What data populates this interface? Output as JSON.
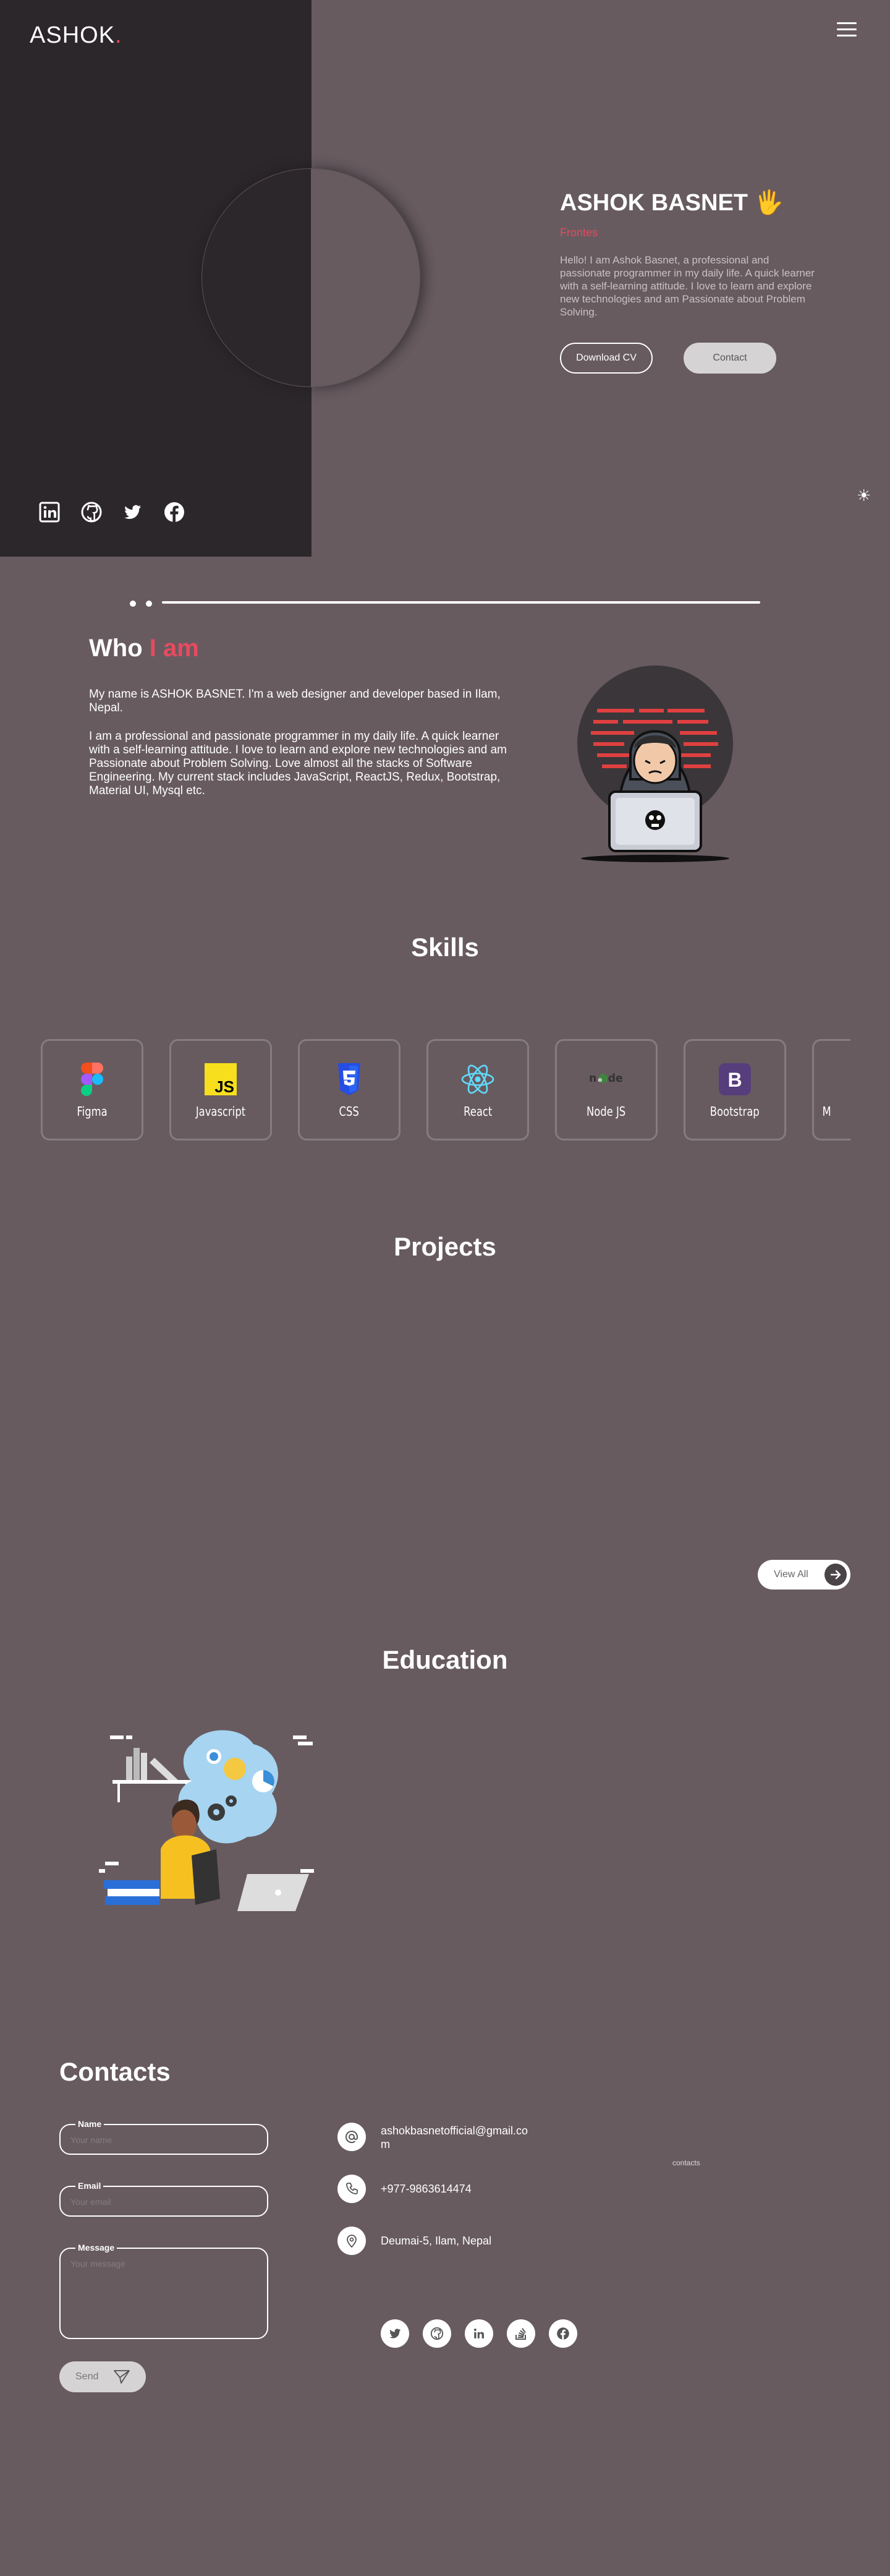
{
  "header": {
    "logo": "ASHOK",
    "logo_dot": "."
  },
  "hero": {
    "name": "ASHOK BASNET",
    "wave": "🖐",
    "role": "Frontes",
    "bio": "Hello! I am Ashok Basnet, a professional and passionate programmer in my daily life. A quick learner with a self-learning attitude. I love to learn and explore new technologies and am Passionate about Problem Solving.",
    "download_cv": "Download CV",
    "contact": "Contact",
    "theme_toggle": "☀",
    "socials": [
      "linkedin-icon",
      "github-icon",
      "twitter-icon",
      "facebook-icon"
    ]
  },
  "about": {
    "title_a": "Who",
    "title_b": "I am",
    "p1": "My name is ASHOK BASNET. I'm a web designer and developer based in Ilam, Nepal.",
    "p2": "I am a professional and passionate programmer in my daily life. A quick learner with a self-learning attitude. I love to learn and explore new technologies and am Passionate about Problem Solving. Love almost all the stacks of Software Engineering. My current stack includes JavaScript, ReactJS, Redux, Bootstrap, Material UI, Mysql etc."
  },
  "skills": {
    "title": "Skills",
    "items": [
      {
        "label": "Figma",
        "icon": "figma-icon"
      },
      {
        "label": "Javascript",
        "icon": "javascript-icon"
      },
      {
        "label": "CSS",
        "icon": "css-icon"
      },
      {
        "label": "React",
        "icon": "react-icon"
      },
      {
        "label": "Node JS",
        "icon": "nodejs-icon"
      },
      {
        "label": "Bootstrap",
        "icon": "bootstrap-icon"
      },
      {
        "label": "M",
        "icon": "mui-icon"
      }
    ]
  },
  "projects": {
    "title": "Projects",
    "view_all": "View All"
  },
  "education": {
    "title": "Education"
  },
  "contacts": {
    "title": "Contacts",
    "name_label": "Name",
    "name_placeholder": "Your name",
    "email_label": "Email",
    "email_placeholder": "Your email",
    "message_label": "Message",
    "message_placeholder": "Your message",
    "send": "Send",
    "email": "ashokbasnetofficial@gmail.com",
    "phone": "+977-9863614474",
    "address": "Deumai-5, Ilam, Nepal",
    "broken_image_alt": "contacts",
    "socials": [
      "twitter-icon",
      "github-icon",
      "linkedin-icon",
      "stackoverflow-icon",
      "facebook-icon"
    ]
  },
  "colors": {
    "accent": "#e84a5f",
    "bg": "#675b60",
    "panel": "#2c272b"
  }
}
